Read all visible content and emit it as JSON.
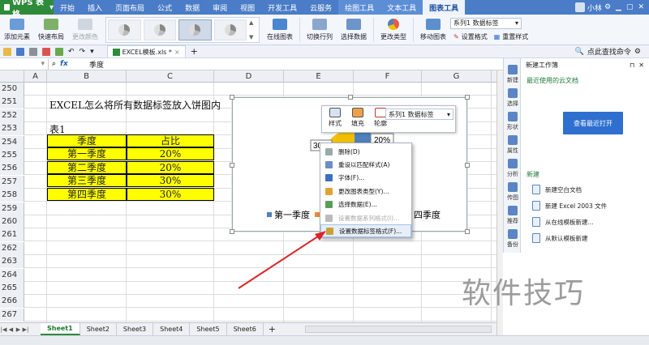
{
  "app": {
    "name": "WPS 表格"
  },
  "menu": {
    "items": [
      "开始",
      "插入",
      "页面布局",
      "公式",
      "数据",
      "审阅",
      "视图",
      "开发工具",
      "云服务",
      "绘图工具",
      "文本工具",
      "图表工具"
    ],
    "active_index": 11,
    "context_indices": [
      9,
      10,
      11
    ]
  },
  "user": {
    "name": "小林"
  },
  "ribbon": {
    "add_element": "添加元素",
    "quick_layout": "快速布局",
    "change_color": "更改颜色",
    "online_chart": "在线图表",
    "switch_row_col": "切换行列",
    "select_data": "选择数据",
    "change_type": "更改类型",
    "move_chart": "移动图表",
    "series_combo": "系列1 数据标签",
    "set_format": "设置格式",
    "reset_style": "重置样式"
  },
  "quickaccess": {
    "doc_tab": "EXCEL模板.xls *"
  },
  "formula_bar": {
    "fx": "fx",
    "content": "季度"
  },
  "columns": [
    "A",
    "B",
    "C",
    "D",
    "E",
    "F",
    "G"
  ],
  "rows": [
    "250",
    "251",
    "252",
    "253",
    "254",
    "255",
    "256",
    "257",
    "258",
    "259",
    "260",
    "261",
    "262",
    "263",
    "264",
    "265",
    "266",
    "267"
  ],
  "sheet": {
    "title_text": "EXCEL怎么将所有数据标签放入饼图内",
    "table_label": "表1",
    "headers": [
      "季度",
      "占比"
    ],
    "data": [
      [
        "第一季度",
        "20%"
      ],
      [
        "第二季度",
        "20%"
      ],
      [
        "第三季度",
        "30%"
      ],
      [
        "第四季度",
        "30%"
      ]
    ]
  },
  "chart_data": {
    "type": "pie",
    "categories": [
      "第一季度",
      "第二季度",
      "第三季度",
      "第四季度"
    ],
    "values": [
      20,
      20,
      30,
      30
    ],
    "visible_labels": [
      "30%",
      "20%"
    ],
    "legend_text": {
      "first": "第一季度",
      "second_partial": "第",
      "fourth_partial": "四季度"
    },
    "legend_position": "bottom",
    "colors": [
      "#4f81bd",
      "#e8893b",
      "#a5a5a5",
      "#f2c000"
    ]
  },
  "mini_toolbar": {
    "style": "样式",
    "fill": "填充",
    "outline": "轮廓",
    "series": "系列1 数据标签"
  },
  "context_menu": [
    {
      "label": "删除(D)",
      "enabled": true
    },
    {
      "label": "重设以匹配样式(A)",
      "enabled": true
    },
    {
      "label": "字体(F)...",
      "enabled": true
    },
    {
      "label": "更改图表类型(Y)...",
      "enabled": true
    },
    {
      "label": "选择数据(E)...",
      "enabled": true
    },
    {
      "label": "设置数据系列格式(I)...",
      "enabled": false
    },
    {
      "label": "设置数据标签格式(F)...",
      "enabled": true,
      "highlighted": true
    }
  ],
  "sheet_tabs": [
    "Sheet1",
    "Sheet2",
    "Sheet3",
    "Sheet4",
    "Sheet5",
    "Sheet6"
  ],
  "active_sheet": "Sheet1",
  "task_pane": {
    "title": "新建工作簿",
    "search_hint": "点此查找命令",
    "recent_section": "最近使用的云文档",
    "open_recent_button": "查看最近打开",
    "new_section": "新建",
    "links": [
      "新建空白文档",
      "新建 Excel 2003 文件",
      "从在线模板新建...",
      "从默认模板新建"
    ],
    "vtabs": [
      "新建",
      "选择",
      "形状",
      "属性",
      "分析",
      "传图",
      "推荐",
      "备份"
    ]
  },
  "watermark": "软件技巧"
}
